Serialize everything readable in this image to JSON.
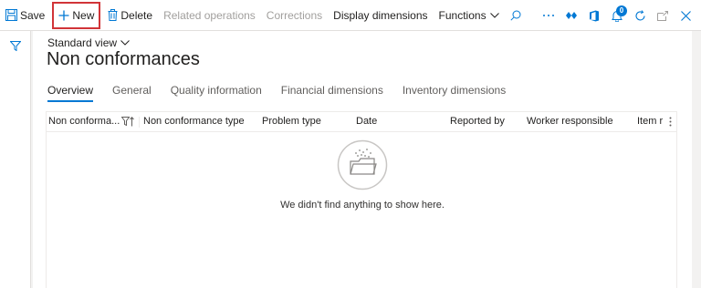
{
  "toolbar": {
    "save_label": "Save",
    "new_label": "New",
    "delete_label": "Delete",
    "related_label": "Related operations",
    "corrections_label": "Corrections",
    "display_dimensions_label": "Display dimensions",
    "functions_label": "Functions",
    "notification_count": "0"
  },
  "view": {
    "selector": "Standard view",
    "title": "Non conformances"
  },
  "tabs": [
    "Overview",
    "General",
    "Quality information",
    "Financial dimensions",
    "Inventory dimensions"
  ],
  "grid": {
    "columns": [
      "Non conforma...",
      "Non conformance type",
      "Problem type",
      "Date",
      "Reported by",
      "Worker responsible",
      "Item r"
    ],
    "empty_message": "We didn't find anything to show here."
  },
  "colors": {
    "accent": "#0078d4",
    "highlight_border": "#d13438"
  }
}
